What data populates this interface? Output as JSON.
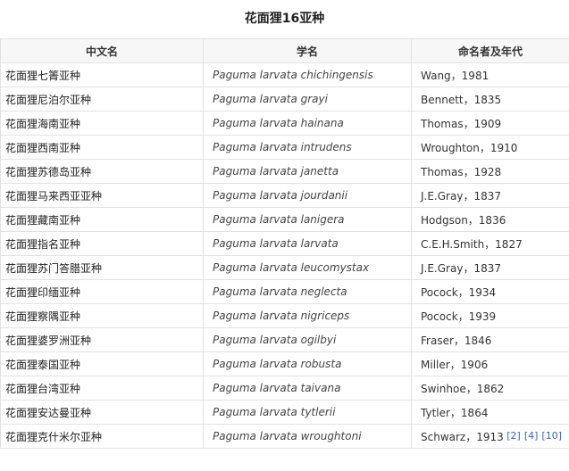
{
  "table": {
    "title": "花面狸16亚种",
    "headers": [
      "中文名",
      "学名",
      "命名者及年代"
    ],
    "rows": [
      [
        "花面狸七箐亚种",
        "Paguma larvata chichingensis",
        "Wang，1981"
      ],
      [
        "花面狸尼泊尔亚种",
        "Paguma larvata grayi",
        "Bennett，1835"
      ],
      [
        "花面狸海南亚种",
        "Paguma larvata hainana",
        "Thomas，1909"
      ],
      [
        "花面狸西南亚种",
        "Paguma larvata intrudens",
        "Wroughton，1910"
      ],
      [
        "花面狸苏德岛亚种",
        "Paguma larvata janetta",
        "Thomas，1928"
      ],
      [
        "花面狸马来西亚亚种",
        "Paguma larvata jourdanii",
        "J.E.Gray，1837"
      ],
      [
        "花面狸藏南亚种",
        "Paguma larvata lanigera",
        "Hodgson，1836"
      ],
      [
        "花面狸指名亚种",
        "Paguma larvata larvata",
        "C.E.H.Smith，1827"
      ],
      [
        "花面狸苏门答腊亚种",
        "Paguma larvata leucomystax",
        "J.E.Gray，1837"
      ],
      [
        "花面狸印缅亚种",
        "Paguma larvata neglecta",
        "Pocock，1934"
      ],
      [
        "花面狸察隅亚种",
        "Paguma larvata nigriceps",
        "Pocock，1939"
      ],
      [
        "花面狸婆罗洲亚种",
        "Paguma larvata ogilbyi",
        "Fraser，1846"
      ],
      [
        "花面狸泰国亚种",
        "Paguma larvata robusta",
        "Miller，1906"
      ],
      [
        "花面狸台湾亚种",
        "Paguma larvata taivana",
        "Swinhoe，1862"
      ],
      [
        "花面狸安达曼亚种",
        "Paguma larvata tytlerii",
        "Tytler，1864"
      ],
      [
        "花面狸克什米尔亚种",
        "Paguma larvata wroughtoni",
        "Schwarz，1913"
      ]
    ],
    "references": [
      "[2]",
      "[4]",
      "[10]"
    ]
  }
}
